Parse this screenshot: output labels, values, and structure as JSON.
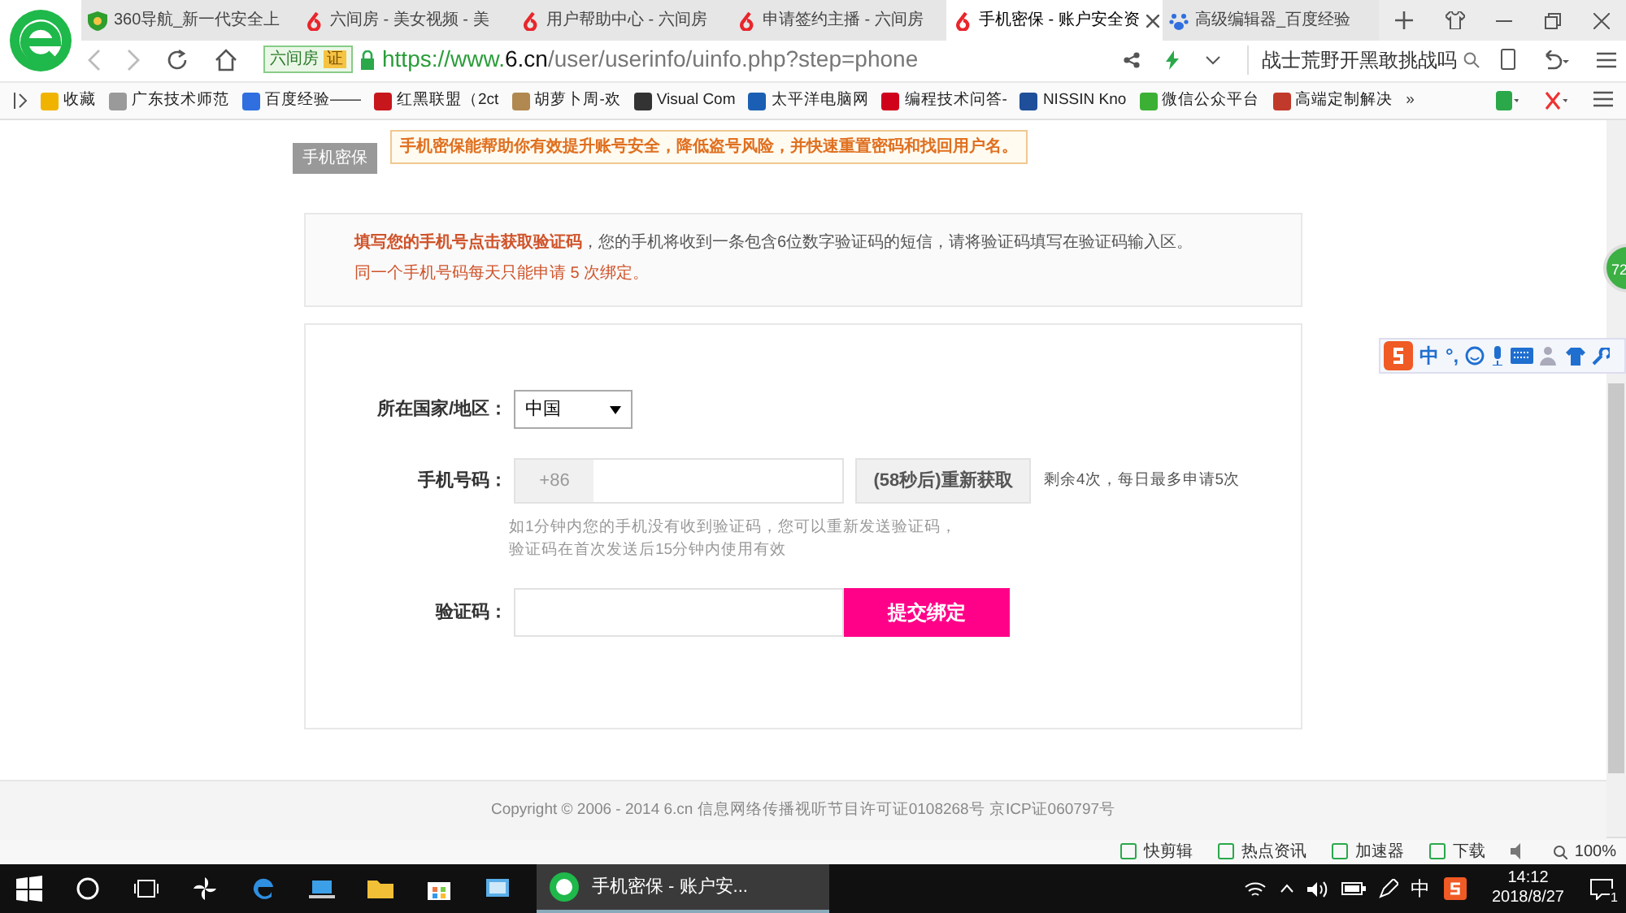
{
  "tabs": [
    {
      "label": "360导航_新一代安全上",
      "kind": "shield",
      "selected": false
    },
    {
      "label": "六间房 - 美女视频 - 美",
      "kind": "six",
      "selected": false
    },
    {
      "label": "用户帮助中心 - 六间房",
      "kind": "six",
      "selected": false
    },
    {
      "label": "申请签约主播 - 六间房",
      "kind": "six",
      "selected": false
    },
    {
      "label": "手机密保 - 账户安全资",
      "kind": "six",
      "selected": true
    },
    {
      "label": "高级编辑器_百度经验",
      "kind": "paw",
      "selected": false
    }
  ],
  "address_bar": {
    "site_badge": "六间房",
    "badge_mark": "证",
    "url_prefix": "https://www.",
    "url_domain": "6.cn",
    "url_path": "/user/userinfo/uinfo.php?step=phone",
    "search_text": "战士荒野开黑敢挑战吗"
  },
  "bookmarks": [
    {
      "label": "收藏",
      "color": "#f0b400"
    },
    {
      "label": "广东技术师范",
      "color": "#9a9a9a"
    },
    {
      "label": "百度经验——",
      "color": "#2f6fe0"
    },
    {
      "label": "红黑联盟（2ct",
      "color": "#c8161d"
    },
    {
      "label": "胡萝卜周-欢",
      "color": "#b08850"
    },
    {
      "label": "Visual Com",
      "color": "#333333"
    },
    {
      "label": "太平洋电脑网",
      "color": "#1a5fb4"
    },
    {
      "label": "编程技术问答-",
      "color": "#d0021b"
    },
    {
      "label": "NISSIN Kno",
      "color": "#1f4e9a"
    },
    {
      "label": "微信公众平台",
      "color": "#3cb034"
    },
    {
      "label": "高端定制解决",
      "color": "#c0392b"
    }
  ],
  "bookmarks_more": "»",
  "page": {
    "section_tag": "手机密保",
    "tooltip": "手机密保能帮助你有效提升账号安全，降低盗号风险，并快速重置密码和找回用户名。",
    "notice": "**填写您的手机号点击获取验证码**，您的手机将收到一条包含6位数字验证码的短信，请将验证码填写在验证码输入区。",
    "notice_limit": "同一个手机号码每天只能申请 5 次绑定。",
    "country_label": "所在国家/地区：",
    "country_value": "中国",
    "phone_label": "手机号码：",
    "phone_prefix": "+86",
    "resend_button": "(58秒后)重新获取",
    "resend_disabled": true,
    "remaining": "剩余4次，每日最多申请5次",
    "hint_lines": [
      "如1分钟内您的手机没有收到验证码，您可以重新发送验证码，",
      "验证码在首次发送后15分钟内使用有效"
    ],
    "code_label": "验证码：",
    "submit_button": "提交绑定"
  },
  "footer": "Copyright © 2006 - 2014 6.cn 信息网络传播视听节目许可证0108268号 京ICP证060797号",
  "floating_badge": "72",
  "ime_bar": {
    "mode": "中",
    "punct": "°,"
  },
  "status_bar": [
    "快剪辑",
    "热点资讯",
    "加速器",
    "下载"
  ],
  "zoom": "100%",
  "taskbar": {
    "app": "手机密保 - 账户安...",
    "ime": "中",
    "time": "14:12",
    "date": "2018/8/27",
    "notifications": "1"
  }
}
